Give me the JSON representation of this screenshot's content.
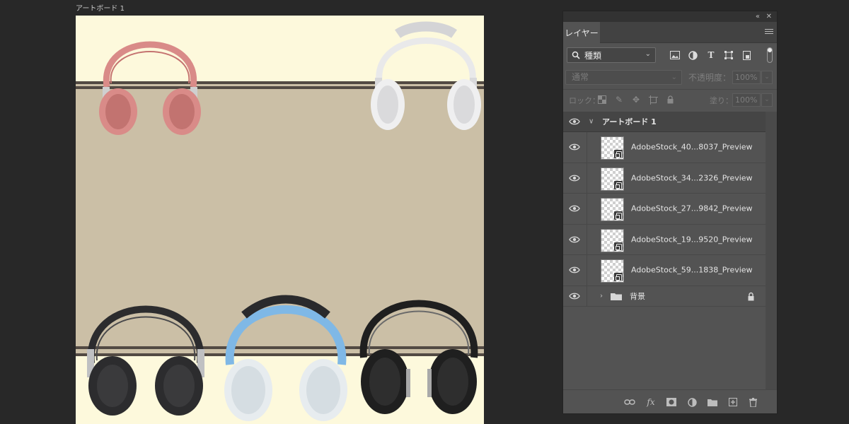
{
  "artboard": {
    "label": "アートボード 1",
    "colors": {
      "cream": "#fdf9dc",
      "taupe": "#cbbfa6",
      "stripe": "#524a43"
    },
    "images": [
      {
        "name": "red-headphones",
        "color": "#d98b88"
      },
      {
        "name": "white-headphones",
        "color": "#e9e9ea"
      },
      {
        "name": "black-headphones",
        "color": "#2c2c2e"
      },
      {
        "name": "blue-white-headphones",
        "color": "#7fb8e6"
      },
      {
        "name": "black-silver-headphones",
        "color": "#1f1f1f"
      }
    ]
  },
  "panel": {
    "tab_label": "レイヤー",
    "filter_label": "種類",
    "blend_mode": "通常",
    "opacity_label": "不透明度：",
    "opacity_value": "100%",
    "lock_label": "ロック：",
    "fill_label": "塗り：",
    "fill_value": "100%",
    "filter_icons": [
      "pixel-filter-icon",
      "adjustment-filter-icon",
      "type-filter-icon",
      "shape-filter-icon",
      "smart-object-filter-icon"
    ],
    "group_name": "アートボード 1",
    "layers": [
      {
        "name": "AdobeStock_40...8037_Preview"
      },
      {
        "name": "AdobeStock_34...2326_Preview"
      },
      {
        "name": "AdobeStock_27...9842_Preview"
      },
      {
        "name": "AdobeStock_19...9520_Preview"
      },
      {
        "name": "AdobeStock_59...1838_Preview"
      }
    ],
    "background_name": "背景",
    "footer_icons": [
      "link-layers-icon",
      "fx-icon",
      "mask-icon",
      "adjustment-layer-icon",
      "new-group-icon",
      "new-layer-icon",
      "trash-icon"
    ]
  }
}
